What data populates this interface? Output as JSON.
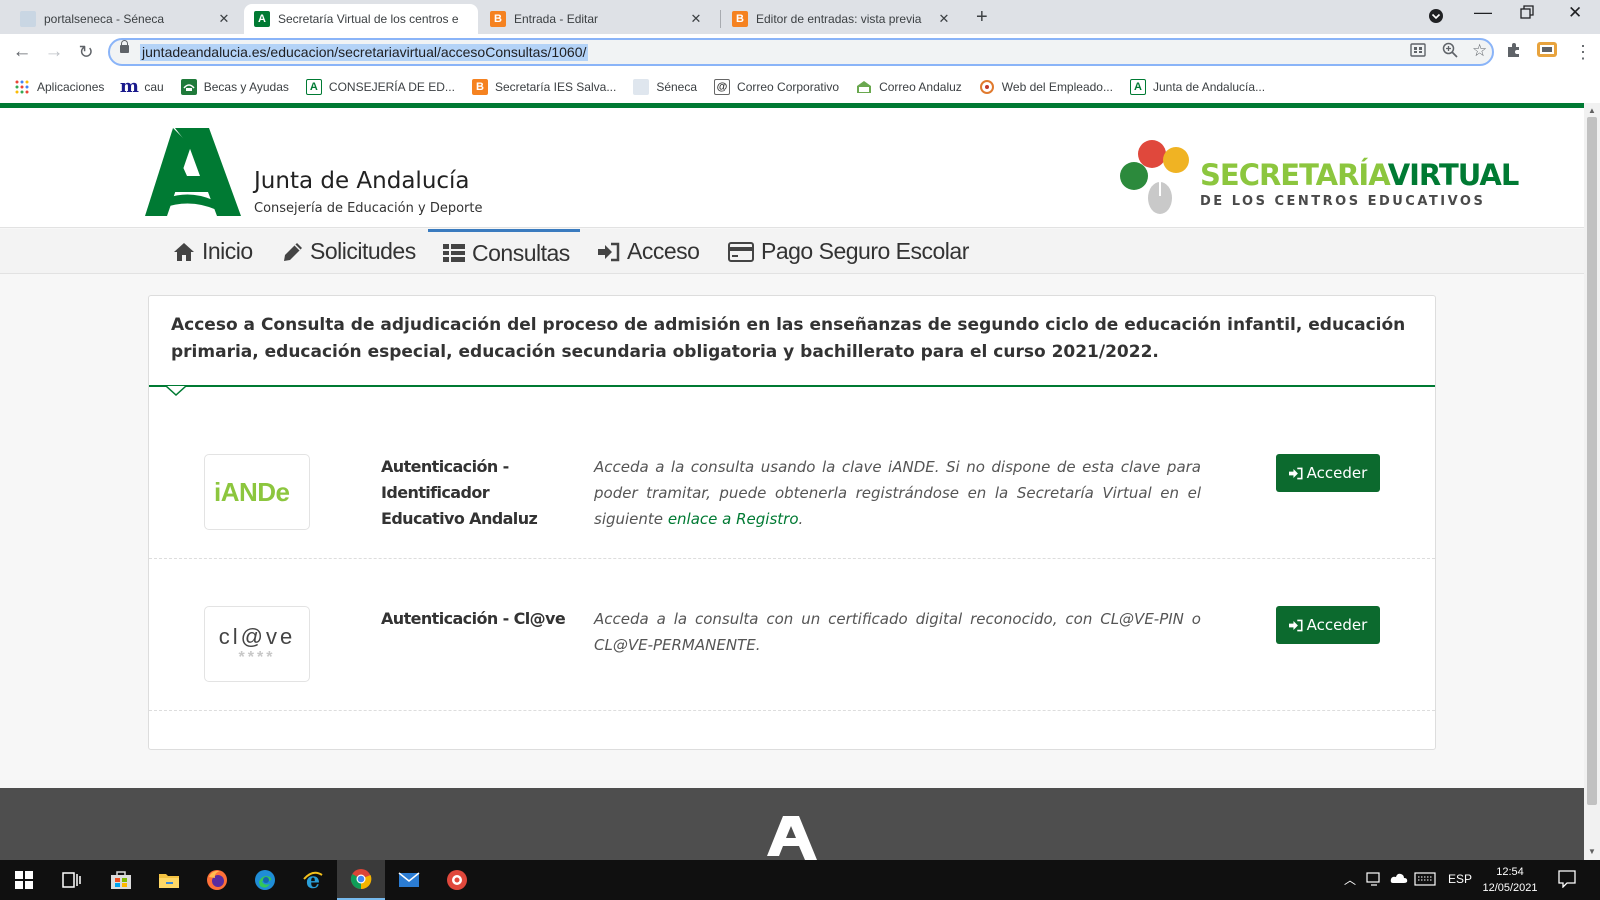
{
  "browser": {
    "tabs": [
      {
        "title": "portalseneca - Séneca",
        "active": false
      },
      {
        "title": "Secretaría Virtual de los centros e",
        "active": true
      },
      {
        "title": "Entrada - Editar",
        "active": false
      },
      {
        "title": "Editor de entradas: vista previa",
        "active": false
      }
    ],
    "url": "juntadeandalucia.es/educacion/secretariavirtual/accesoConsultas/1060/",
    "bookmarks": [
      {
        "label": "Aplicaciones"
      },
      {
        "label": "cau"
      },
      {
        "label": "Becas y Ayudas"
      },
      {
        "label": "CONSEJERÍA DE ED..."
      },
      {
        "label": "Secretaría IES Salva..."
      },
      {
        "label": "Séneca"
      },
      {
        "label": "Correo Corporativo"
      },
      {
        "label": "Correo Andaluz"
      },
      {
        "label": "Web del Empleado..."
      },
      {
        "label": "Junta de Andalucía..."
      }
    ]
  },
  "header": {
    "org_title": "Junta de Andalucía",
    "org_subtitle": "Consejería de Educación y Deporte",
    "sv_title_1": "SECRETARÍA",
    "sv_title_2": "VIRTUAL",
    "sv_subtitle": "DE LOS CENTROS EDUCATIVOS"
  },
  "nav": {
    "items": [
      {
        "label": "Inicio",
        "active": false
      },
      {
        "label": "Solicitudes",
        "active": false
      },
      {
        "label": "Consultas",
        "active": true
      },
      {
        "label": "Acceso",
        "active": false
      },
      {
        "label": "Pago Seguro Escolar",
        "active": false
      }
    ]
  },
  "main": {
    "title": "Acceso a Consulta de adjudicación del proceso de admisión en las enseñanzas de segundo ciclo de educación infantil, educación primaria, educación especial, educación secundaria obligatoria y bachillerato para el curso 2021/2022.",
    "auth_methods": [
      {
        "logo_text": "iANDe",
        "name": "Autenticación - Identificador Educativo Andaluz",
        "description": "Acceda a la consulta usando la clave iANDE. Si no dispone de esta clave para poder tramitar, puede obtenerla registrándose en la Secretaría Virtual en el siguiente",
        "link_text": "enlace a Registro",
        "description_end": ".",
        "button": "Acceder"
      },
      {
        "logo_text": "cl@ve",
        "logo_stars": "****",
        "name": "Autenticación - Cl@ve",
        "description": "Acceda a la consulta con un certificado digital reconocido, con CL@VE-PIN o CL@VE-PERMANENTE.",
        "button": "Acceder"
      }
    ]
  },
  "taskbar": {
    "language": "ESP",
    "time": "12:54",
    "date": "12/05/2021"
  },
  "colors": {
    "junta_green": "#007a33",
    "light_green": "#8cc63e",
    "button_green": "#0c6a2e",
    "nav_active_border": "#3a7bbf"
  }
}
